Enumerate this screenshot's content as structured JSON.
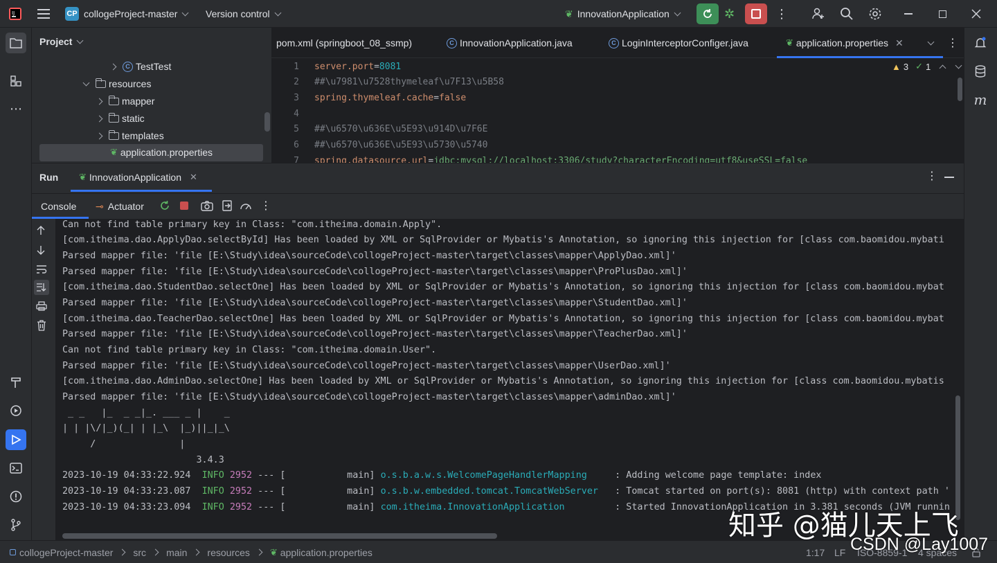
{
  "titlebar": {
    "project_badge": "CP",
    "project_name": "collogeProject-master",
    "vcs": "Version control",
    "run_config": "InnovationApplication"
  },
  "project_panel": {
    "title": "Project",
    "items": [
      {
        "label": "TestTest",
        "kind": "class"
      },
      {
        "label": "resources",
        "kind": "folder"
      },
      {
        "label": "mapper",
        "kind": "folder"
      },
      {
        "label": "static",
        "kind": "folder"
      },
      {
        "label": "templates",
        "kind": "folder"
      },
      {
        "label": "application.properties",
        "kind": "file"
      }
    ]
  },
  "editor": {
    "tabs": [
      {
        "label": "pom.xml (springboot_08_ssmp)"
      },
      {
        "label": "InnovationApplication.java"
      },
      {
        "label": "LoginInterceptorConfiger.java"
      },
      {
        "label": "application.properties"
      }
    ],
    "warnings": "3",
    "checks": "1",
    "lines": [
      {
        "n": "1",
        "key": "server.port",
        "eq": "=",
        "val": "8081"
      },
      {
        "n": "2",
        "comment": "##\\u7981\\u7528thymeleaf\\u7F13\\u5B58"
      },
      {
        "n": "3",
        "key": "spring.thymeleaf.cache",
        "eq": "=",
        "val": "false"
      },
      {
        "n": "4",
        "comment": ""
      },
      {
        "n": "5",
        "comment": "##\\u6570\\u636E\\u5E93\\u914D\\u7F6E"
      },
      {
        "n": "6",
        "comment": "##\\u6570\\u636E\\u5E93\\u5730\\u5740"
      },
      {
        "n": "7",
        "key": "spring.datasource.url",
        "eq": "=",
        "val": "jdbc:mysql://localhost:3306/study?characterEncoding=utf8&useSSL=false"
      }
    ]
  },
  "run": {
    "title": "Run",
    "tab": "InnovationApplication",
    "subtabs": [
      "Console",
      "Actuator"
    ],
    "console": [
      "Can not find table primary key in Class: \"com.itheima.domain.Apply\".",
      "[com.itheima.dao.ApplyDao.selectById] Has been loaded by XML or SqlProvider or Mybatis's Annotation, so ignoring this injection for [class com.baomidou.mybati",
      "Parsed mapper file: 'file [E:\\Study\\idea\\sourceCode\\collogeProject-master\\target\\classes\\mapper\\ApplyDao.xml]'",
      "Parsed mapper file: 'file [E:\\Study\\idea\\sourceCode\\collogeProject-master\\target\\classes\\mapper\\ProPlusDao.xml]'",
      "[com.itheima.dao.StudentDao.selectOne] Has been loaded by XML or SqlProvider or Mybatis's Annotation, so ignoring this injection for [class com.baomidou.mybat",
      "Parsed mapper file: 'file [E:\\Study\\idea\\sourceCode\\collogeProject-master\\target\\classes\\mapper\\StudentDao.xml]'",
      "[com.itheima.dao.TeacherDao.selectOne] Has been loaded by XML or SqlProvider or Mybatis's Annotation, so ignoring this injection for [class com.baomidou.mybat",
      "Parsed mapper file: 'file [E:\\Study\\idea\\sourceCode\\collogeProject-master\\target\\classes\\mapper\\TeacherDao.xml]'",
      "Can not find table primary key in Class: \"com.itheima.domain.User\".",
      "Parsed mapper file: 'file [E:\\Study\\idea\\sourceCode\\collogeProject-master\\target\\classes\\mapper\\UserDao.xml]'",
      "[com.itheima.dao.AdminDao.selectOne] Has been loaded by XML or SqlProvider or Mybatis's Annotation, so ignoring this injection for [class com.baomidou.mybatis",
      "Parsed mapper file: 'file [E:\\Study\\idea\\sourceCode\\collogeProject-master\\target\\classes\\mapper\\adminDao.xml]'",
      " _ _   |_  _ _|_. ___ _ |    _",
      "| | |\\/|_)(_| | |_\\  |_)||_|_\\",
      "     /               |",
      "                        3.4.3"
    ],
    "log": [
      {
        "ts": "2023-10-19 04:33:22.924",
        "level": "INFO",
        "pid": "2952",
        "mid": " --- [           main] ",
        "logger": "o.s.b.a.w.s.WelcomePageHandlerMapping    ",
        "msg": " : Adding welcome page template: index"
      },
      {
        "ts": "2023-10-19 04:33:23.087",
        "level": "INFO",
        "pid": "2952",
        "mid": " --- [           main] ",
        "logger": "o.s.b.w.embedded.tomcat.TomcatWebServer  ",
        "msg": " : Tomcat started on port(s): 8081 (http) with context path '"
      },
      {
        "ts": "2023-10-19 04:33:23.094",
        "level": "INFO",
        "pid": "2952",
        "mid": " --- [           main] ",
        "logger": "com.itheima.InnovationApplication        ",
        "msg": " : Started InnovationApplication in 3.381 seconds (JVM runnin"
      }
    ]
  },
  "statusbar": {
    "crumbs": [
      "collogeProject-master",
      "src",
      "main",
      "resources",
      "application.properties"
    ],
    "position": "1:17",
    "line_sep": "LF",
    "encoding": "ISO-8859-1",
    "indent": "4 spaces"
  },
  "watermark": {
    "zhihu": "知乎 @猫儿天上飞",
    "csdn": "CSDN @Lay1007"
  },
  "colors": {
    "accent": "#3574f0",
    "info_green": "#5fb865",
    "logger_teal": "#2aacb8",
    "key_orange": "#cf8e6d",
    "number_blue": "#2aacb8",
    "comment_gray": "#7a7e85",
    "run_green": "#3d8f58",
    "stop_red": "#c94f4f"
  }
}
